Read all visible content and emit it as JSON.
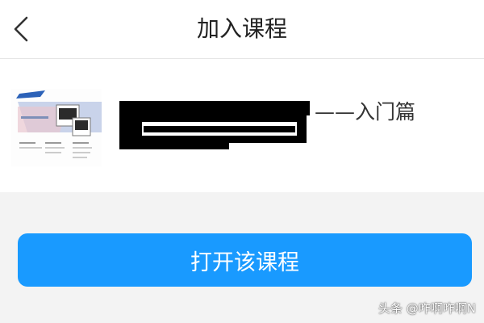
{
  "header": {
    "back_icon": "chevron-left-icon",
    "title": "加入课程"
  },
  "course": {
    "title_suffix": "——入门篇",
    "thumbnail": {
      "captions": [
        "",
        "",
        ""
      ]
    }
  },
  "actions": {
    "open_course_label": "打开该课程"
  },
  "watermark": {
    "text": "头条 @咋啊咋啊N"
  },
  "colors": {
    "primary_button": "#199aff",
    "background": "#f3f3f3",
    "card": "#ffffff"
  }
}
